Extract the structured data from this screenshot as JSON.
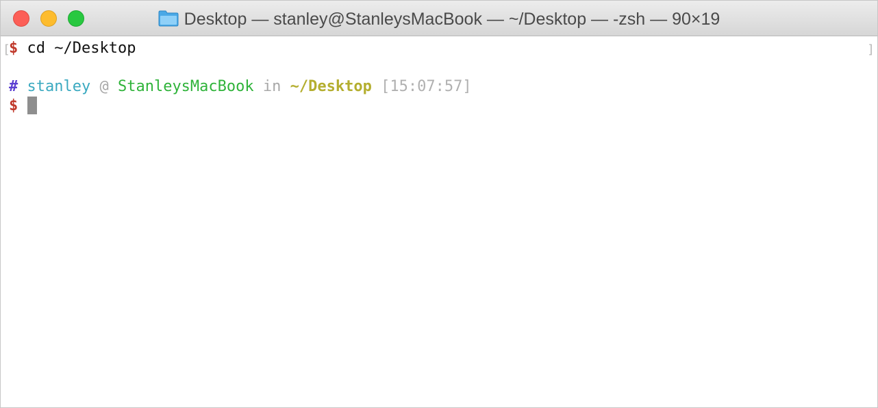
{
  "window": {
    "title": "Desktop — stanley@StanleysMacBook — ~/Desktop — -zsh — 90×19",
    "folder_icon": "folder-icon",
    "colors": {
      "close": "#fc5f57",
      "minimize": "#fdbc2e",
      "zoom": "#28c840"
    }
  },
  "terminal": {
    "mark_left": "[",
    "mark_right": "]",
    "line1": {
      "prompt": "$",
      "command": " cd ~/Desktop"
    },
    "line2": {
      "hash": "#",
      "user": "stanley",
      "at": "@",
      "host": "StanleysMacBook",
      "in": "in",
      "path": "~/Desktop",
      "time": "[15:07:57]"
    },
    "line3": {
      "prompt": "$"
    },
    "colors": {
      "prompt": "#c0392b",
      "hash": "#5b3fd1",
      "user": "#3aa9c0",
      "host": "#2fb33a",
      "path": "#b4ae2f",
      "dim": "#a8a8a8"
    }
  }
}
